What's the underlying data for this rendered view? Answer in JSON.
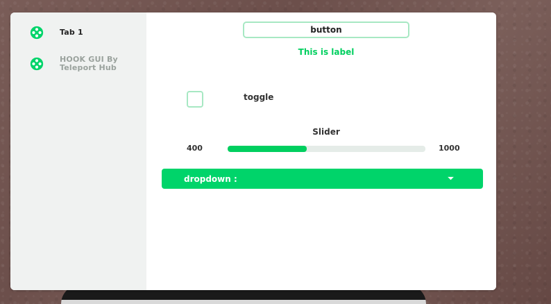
{
  "colors": {
    "accent": "#00d46a",
    "accent_text": "#00cf5f",
    "border": "#a7e8c3",
    "sidebar_bg": "#f0f2f1",
    "window_bg": "#ffffff"
  },
  "sidebar": {
    "items": [
      {
        "label": "Tab 1",
        "icon": "roblox-icon",
        "color": "#222222"
      },
      {
        "label": "HOOK GUI By\nTeleport Hub",
        "icon": "roblox-icon",
        "color": "#9aa29d"
      }
    ]
  },
  "main": {
    "button_label": "button",
    "label_text": "This is label",
    "toggle_label": "toggle",
    "slider": {
      "title": "Slider",
      "min_label": "400",
      "max_label": "1000",
      "fill_fraction": 0.4
    },
    "dropdown_label": "dropdown :"
  }
}
